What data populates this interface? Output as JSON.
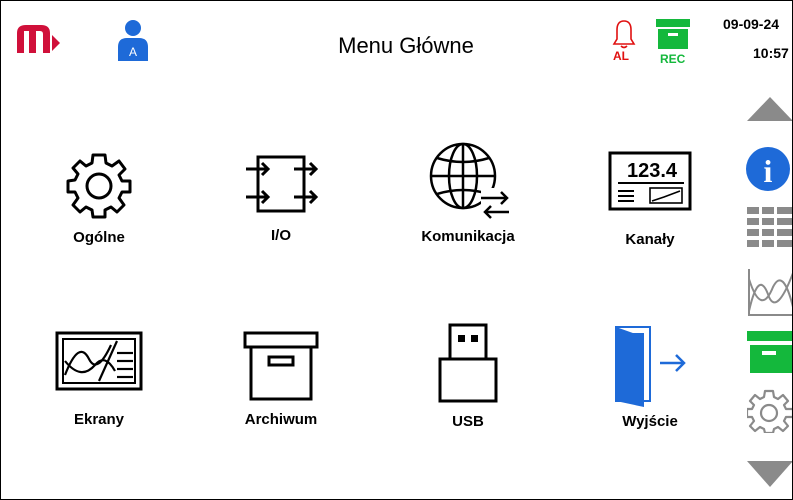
{
  "header": {
    "title": "Menu Główne",
    "user_badge": "A",
    "alarm_label": "AL",
    "rec_label": "REC",
    "date": "09-09-24",
    "time": "10:57"
  },
  "menu": [
    {
      "label": "Ogólne",
      "icon": "gear-icon"
    },
    {
      "label": "I/O",
      "icon": "io-icon"
    },
    {
      "label": "Komunikacja",
      "icon": "globe-arrows-icon"
    },
    {
      "label": "Kanały",
      "icon": "display-123-icon"
    },
    {
      "label": "Ekrany",
      "icon": "chart-screen-icon"
    },
    {
      "label": "Archiwum",
      "icon": "archive-box-icon"
    },
    {
      "label": "USB",
      "icon": "usb-icon"
    },
    {
      "label": "Wyjście",
      "icon": "exit-door-icon"
    }
  ],
  "sidebar": {
    "panel_value": "123.4",
    "info_glyph": "i",
    "icons": [
      "arrow-up-icon",
      "info-icon",
      "table-icon",
      "trend-icon",
      "archive-icon",
      "settings-icon",
      "arrow-down-icon"
    ]
  },
  "colors": {
    "brand_red": "#d0103a",
    "accent_blue": "#1e6ad8",
    "alarm_red": "#e01010",
    "rec_green": "#14b83c",
    "sidebar_gray": "#8a8a8a"
  }
}
